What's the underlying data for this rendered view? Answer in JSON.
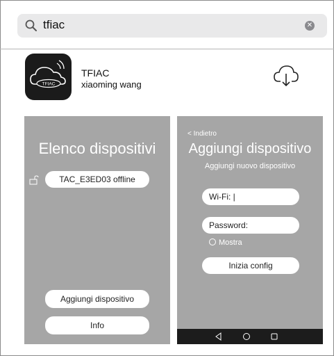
{
  "search": {
    "query": "tfiac",
    "clear_icon": "clear-icon",
    "search_icon": "search-icon"
  },
  "app": {
    "name": "TFIAC",
    "developer": "xiaoming wang",
    "icon_label": "TFIAC",
    "download_icon": "cloud-download-icon"
  },
  "screenshot1": {
    "title": "Elenco dispositivi",
    "device_label": "TAC_E3ED03 offline",
    "add_button": "Aggiungi dispositivo",
    "info_button": "Info"
  },
  "screenshot2": {
    "back": "< Indietro",
    "title": "Aggiungi dispositivo",
    "subtitle": "Aggiungi nuovo dispositivo",
    "wifi_field": "Wi-Fi: |",
    "password_field": "Password:",
    "show_label": "Mostra",
    "start_button": "Inizia config"
  },
  "colors": {
    "screenshot_bg": "#a6a6a6",
    "navbar": "#1c1c1c",
    "search_bg": "#e9e9ea"
  }
}
